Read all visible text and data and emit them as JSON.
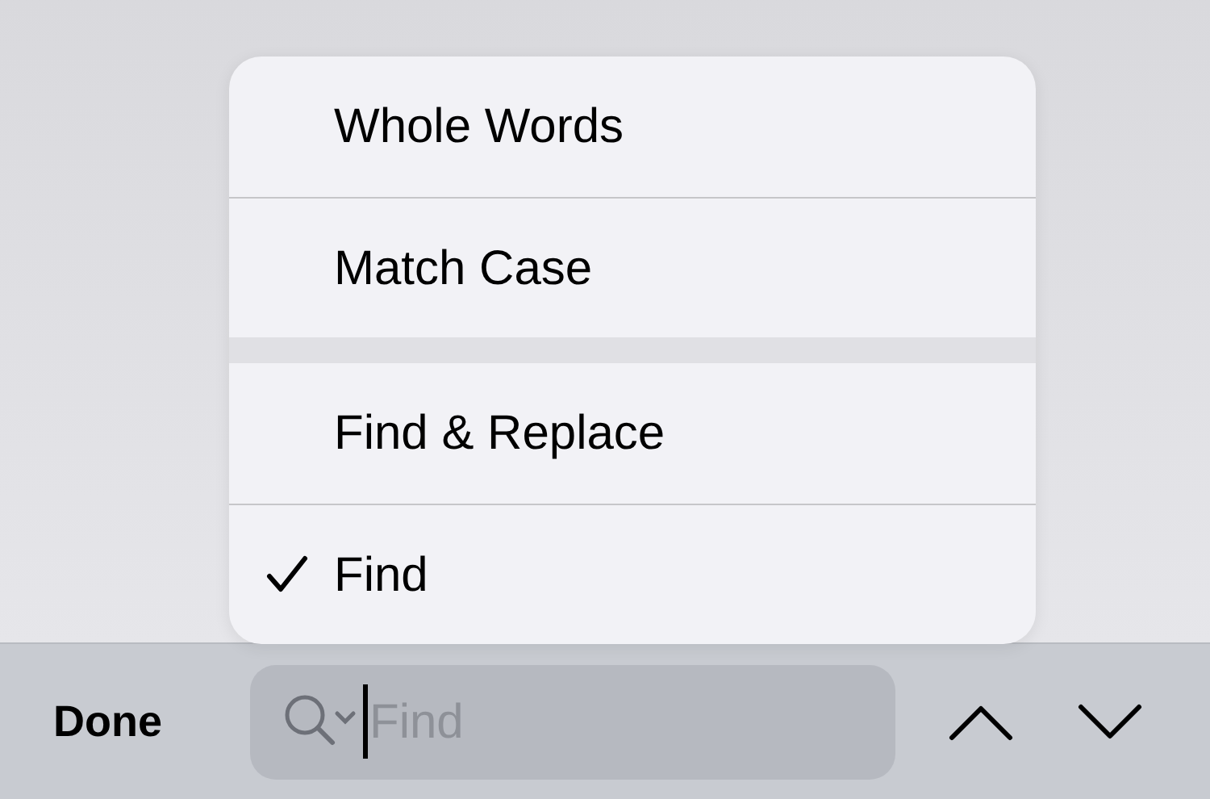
{
  "menu": {
    "groups": [
      {
        "items": [
          {
            "label": "Whole Words",
            "checked": false
          },
          {
            "label": "Match Case",
            "checked": false
          }
        ]
      },
      {
        "items": [
          {
            "label": "Find & Replace",
            "checked": false
          },
          {
            "label": "Find",
            "checked": true
          }
        ]
      }
    ]
  },
  "toolbar": {
    "done_button": "Done",
    "search": {
      "placeholder": "Find"
    }
  }
}
